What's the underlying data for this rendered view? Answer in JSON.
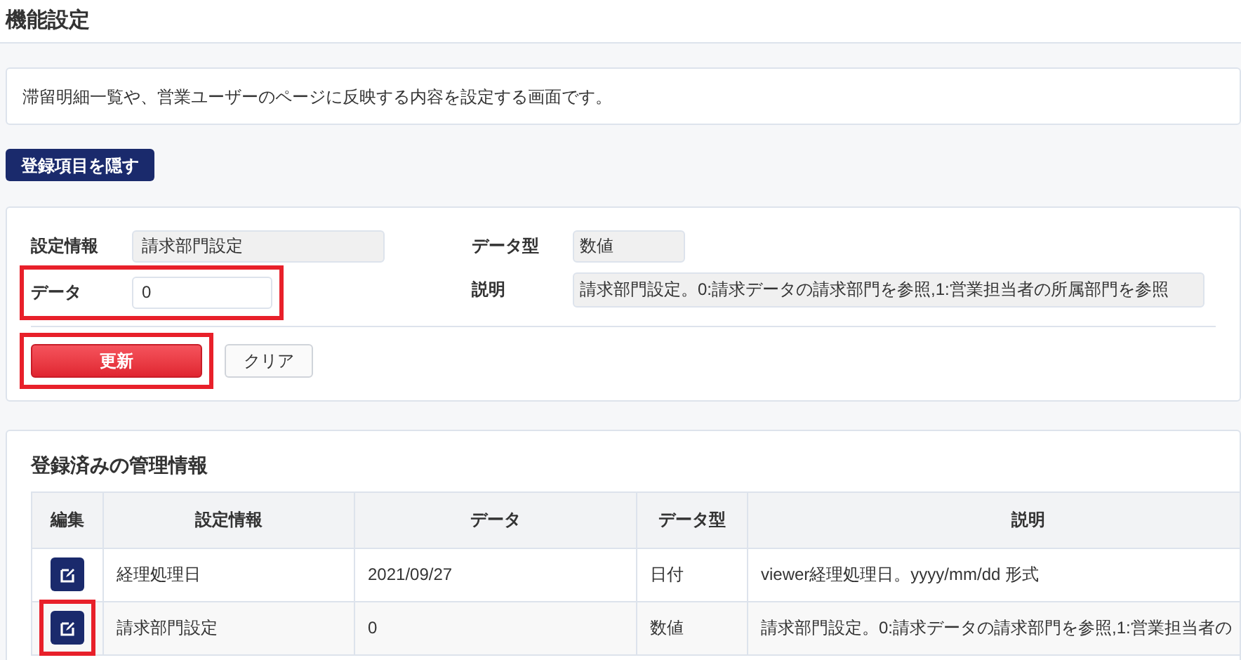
{
  "page_title": "機能設定",
  "description": "滞留明細一覧や、営業ユーザーのページに反映する内容を設定する画面です。",
  "toggle_button": "登録項目を隠す",
  "form": {
    "setting_label": "設定情報",
    "setting_value": "請求部門設定",
    "type_label": "データ型",
    "type_value": "数値",
    "data_label": "データ",
    "data_value": "0",
    "data_highlighted": true,
    "explain_label": "説明",
    "explain_value": "請求部門設定。0:請求データの請求部門を参照,1:営業担当者の所属部門を参照",
    "update_button": "更新",
    "update_highlighted": true,
    "clear_button": "クリア"
  },
  "table": {
    "title": "登録済みの管理情報",
    "edit_header": "編集",
    "columns": [
      "設定情報",
      "データ",
      "データ型",
      "説明"
    ],
    "rows": [
      {
        "highlighted": false,
        "cells": [
          "経理処理日",
          "2021/09/27",
          "日付",
          "viewer経理処理日。yyyy/mm/dd 形式"
        ]
      },
      {
        "highlighted": true,
        "cells": [
          "請求部門設定",
          "0",
          "数値",
          "請求部門設定。0:請求データの請求部門を参照,1:営業担当者の"
        ]
      }
    ]
  }
}
